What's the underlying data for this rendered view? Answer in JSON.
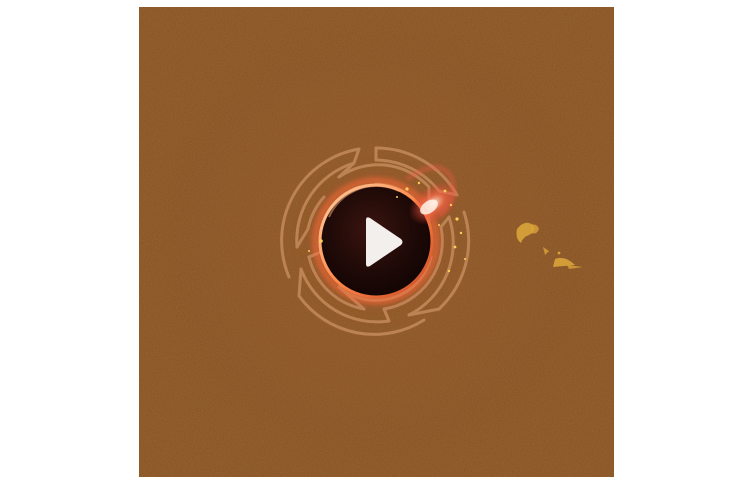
{
  "video": {
    "play_control": {
      "icon": "play-icon",
      "state": "paused"
    }
  },
  "colors": {
    "page_background": "#ffffff",
    "panel_background": "#8a4e20",
    "maze_ring": "#c48a5c",
    "orb_core": "#1a0a08",
    "orb_glow": "#ff5a30",
    "play_icon": "#f3efec",
    "sparkle": "#ffcf5a",
    "gold_ornament": "#d9a33a"
  }
}
